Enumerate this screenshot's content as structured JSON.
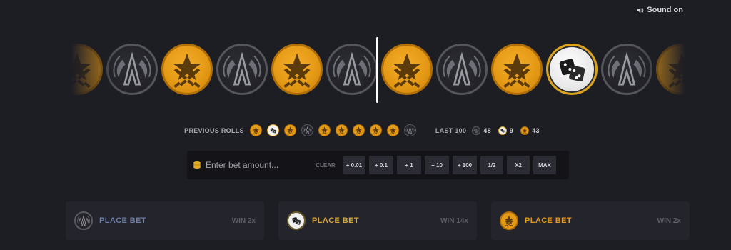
{
  "sound": {
    "label": "Sound on"
  },
  "roller": {
    "coins": [
      {
        "type": "t",
        "partial": "left"
      },
      {
        "type": "ct"
      },
      {
        "type": "t"
      },
      {
        "type": "ct"
      },
      {
        "type": "t"
      },
      {
        "type": "ct"
      },
      {
        "type": "t"
      },
      {
        "type": "ct"
      },
      {
        "type": "t"
      },
      {
        "type": "bonus"
      },
      {
        "type": "ct"
      },
      {
        "type": "t",
        "partial": "right"
      }
    ]
  },
  "previous_rolls": {
    "label": "PREVIOUS ROLLS",
    "items": [
      "t",
      "bonus",
      "t",
      "ct",
      "t",
      "t",
      "t",
      "t",
      "t",
      "ct"
    ]
  },
  "last100": {
    "label": "LAST 100",
    "ct": "48",
    "bonus": "9",
    "t": "43"
  },
  "bet": {
    "placeholder": "Enter bet amount...",
    "clear": "CLEAR",
    "buttons": [
      "+ 0.01",
      "+ 0.1",
      "+ 1",
      "+ 10",
      "+ 100",
      "1/2",
      "X2",
      "MAX"
    ]
  },
  "panels": [
    {
      "type": "ct",
      "label": "PLACE BET",
      "win": "WIN 2x",
      "color": "#6e7da3"
    },
    {
      "type": "bonus",
      "label": "PLACE BET",
      "win": "WIN 14x",
      "color": "#d4a542"
    },
    {
      "type": "t",
      "label": "PLACE BET",
      "win": "WIN 2x",
      "color": "#e29a1a"
    }
  ],
  "colors": {
    "t": "#e59a16",
    "ct": "#232329",
    "bonus": "#f0f0f0",
    "accent": "#dba21a",
    "background": "#1d1d24"
  }
}
